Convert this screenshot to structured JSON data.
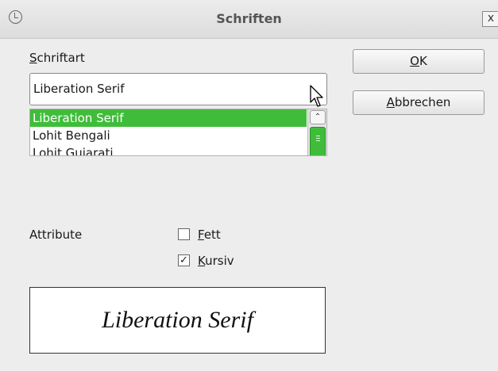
{
  "window": {
    "title": "Schriften",
    "close_label": "x"
  },
  "font": {
    "label_prefix": "",
    "label_access": "S",
    "label_rest": "chriftart",
    "current_value": "Liberation Serif",
    "options": [
      "Liberation Serif",
      "Lohit Bengali",
      "Lohit Gujarati"
    ],
    "selected_option": "Liberation Serif"
  },
  "buttons": {
    "ok_access": "O",
    "ok_rest": "K",
    "cancel_access": "A",
    "cancel_rest": "bbrechen"
  },
  "attributes": {
    "label": "Attribute",
    "bold_access": "F",
    "bold_rest": "ett",
    "bold_checked": false,
    "italic_access": "K",
    "italic_rest": "ursiv",
    "italic_checked": true,
    "check_mark": "✓"
  },
  "preview": {
    "text": "Liberation Serif"
  },
  "icons": {
    "app": "clock-icon",
    "cursor": "mouse-pointer-icon",
    "scroll_up": "chevron-up-icon",
    "scroll_up_glyph": "⌃"
  }
}
